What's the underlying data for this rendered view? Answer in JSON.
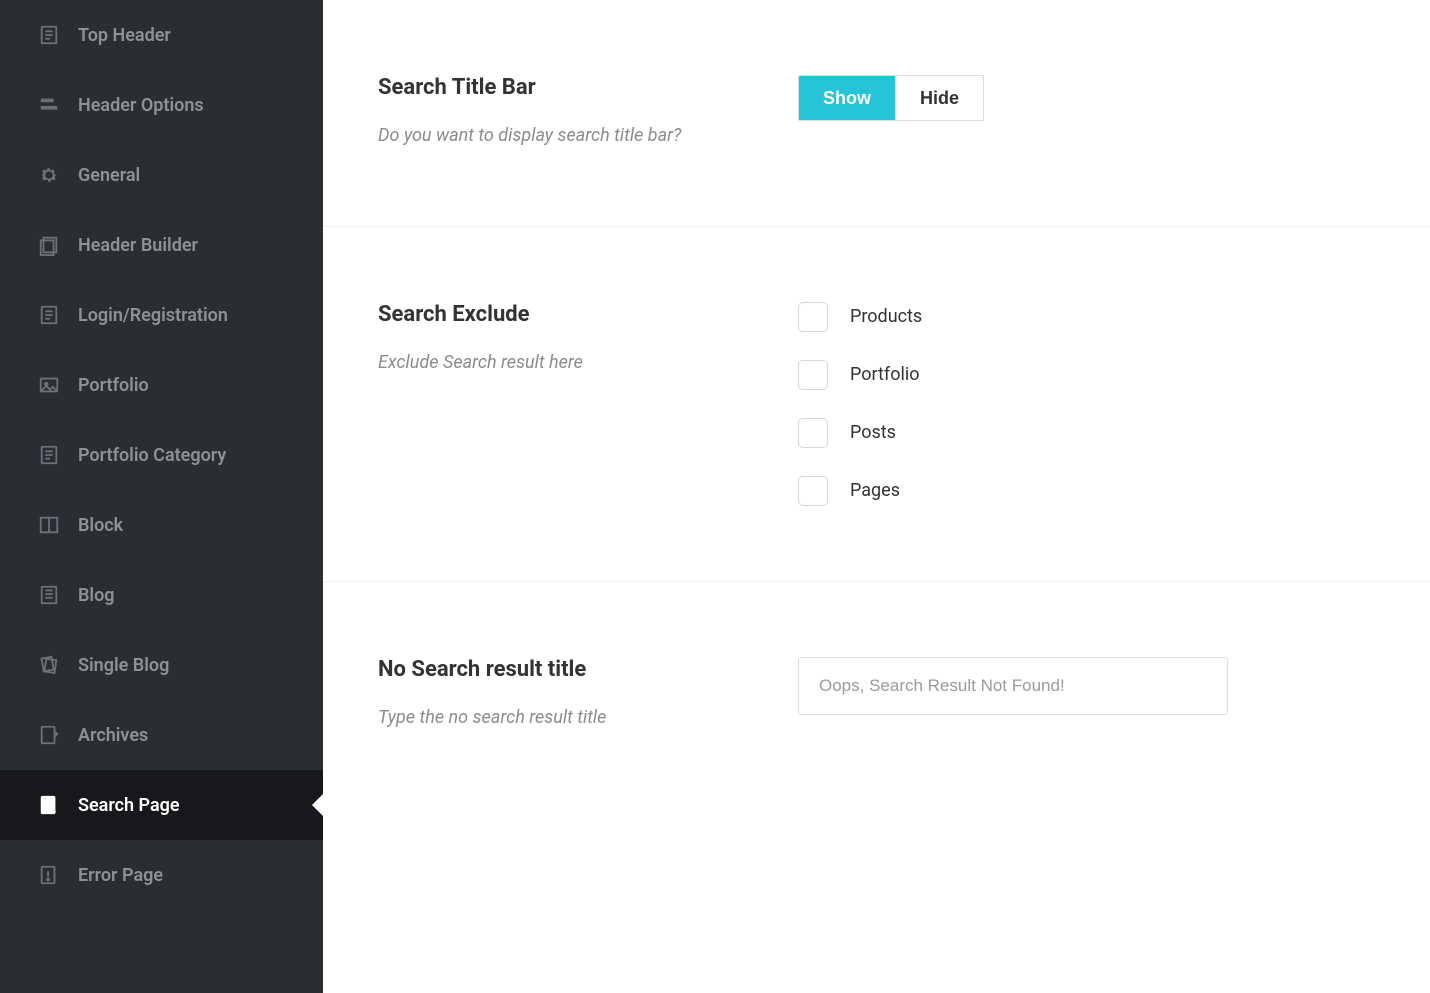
{
  "sidebar": {
    "items": [
      {
        "label": "Top Header",
        "icon": "doc-icon",
        "active": false
      },
      {
        "label": "Header Options",
        "icon": "bars-icon",
        "active": false
      },
      {
        "label": "General",
        "icon": "gear-icon",
        "active": false
      },
      {
        "label": "Header Builder",
        "icon": "stack-icon",
        "active": false
      },
      {
        "label": "Login/Registration",
        "icon": "doc-icon",
        "active": false
      },
      {
        "label": "Portfolio",
        "icon": "image-icon",
        "active": false
      },
      {
        "label": "Portfolio Category",
        "icon": "doc-icon",
        "active": false
      },
      {
        "label": "Block",
        "icon": "layout-icon",
        "active": false
      },
      {
        "label": "Blog",
        "icon": "doclines-icon",
        "active": false
      },
      {
        "label": "Single Blog",
        "icon": "pages-icon",
        "active": false
      },
      {
        "label": "Archives",
        "icon": "archive-icon",
        "active": false
      },
      {
        "label": "Search Page",
        "icon": "search-doc-icon",
        "active": true
      },
      {
        "label": "Error Page",
        "icon": "error-doc-icon",
        "active": false
      }
    ]
  },
  "sections": {
    "titleBar": {
      "title": "Search Title Bar",
      "desc": "Do you want to display search title bar?",
      "showLabel": "Show",
      "hideLabel": "Hide",
      "value": "show"
    },
    "exclude": {
      "title": "Search Exclude",
      "desc": "Exclude Search result here",
      "options": [
        {
          "label": "Products"
        },
        {
          "label": "Portfolio"
        },
        {
          "label": "Posts"
        },
        {
          "label": "Pages"
        }
      ]
    },
    "noResult": {
      "title": "No Search result title",
      "desc": "Type the no search result title",
      "value": "Oops, Search Result Not Found!"
    }
  },
  "colors": {
    "accent": "#27c3d6",
    "sidebarBg": "#2a2e33",
    "sidebarActiveBg": "#16181b"
  }
}
